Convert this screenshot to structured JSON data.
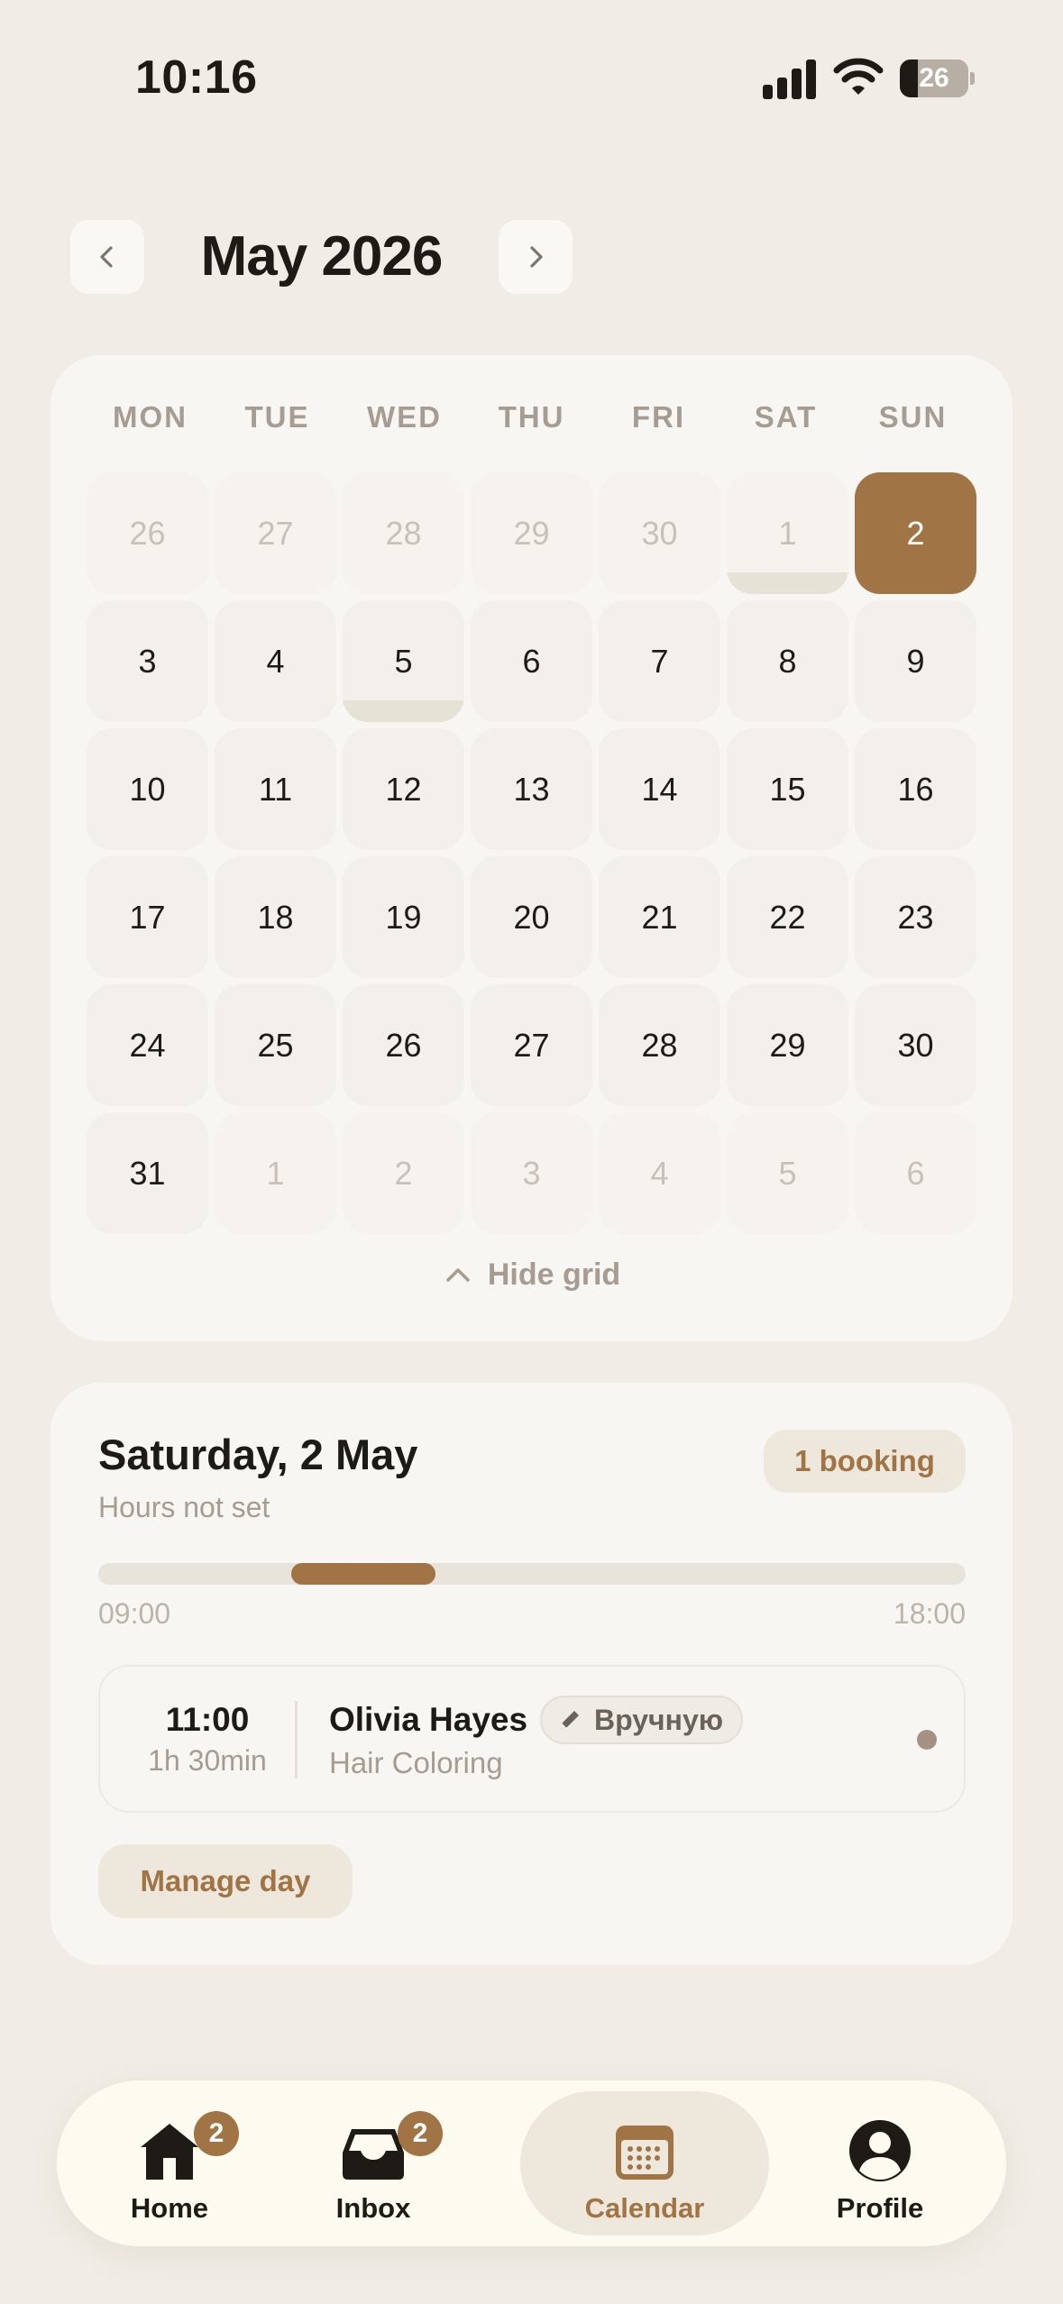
{
  "status_bar": {
    "time": "10:16",
    "battery_level": "26",
    "battery_fraction": 0.26,
    "signal_bars_active": 3,
    "signal_bars_total": 4,
    "icons": [
      "signal-icon",
      "wifi-icon",
      "battery-icon"
    ]
  },
  "header": {
    "month_title": "May 2026",
    "prev_icon": "chevron-left-icon",
    "next_icon": "chevron-right-icon"
  },
  "calendar": {
    "weekdays": [
      "MON",
      "TUE",
      "WED",
      "THU",
      "FRI",
      "SAT",
      "SUN"
    ],
    "weeks": [
      [
        {
          "label": "26",
          "out": true
        },
        {
          "label": "27",
          "out": true
        },
        {
          "label": "28",
          "out": true
        },
        {
          "label": "29",
          "out": true
        },
        {
          "label": "30",
          "out": true
        },
        {
          "label": "1",
          "out": true,
          "marked": true
        },
        {
          "label": "2",
          "selected": true
        }
      ],
      [
        {
          "label": "3"
        },
        {
          "label": "4"
        },
        {
          "label": "5",
          "marked": true
        },
        {
          "label": "6"
        },
        {
          "label": "7"
        },
        {
          "label": "8"
        },
        {
          "label": "9"
        }
      ],
      [
        {
          "label": "10"
        },
        {
          "label": "11"
        },
        {
          "label": "12"
        },
        {
          "label": "13"
        },
        {
          "label": "14"
        },
        {
          "label": "15"
        },
        {
          "label": "16"
        }
      ],
      [
        {
          "label": "17"
        },
        {
          "label": "18"
        },
        {
          "label": "19"
        },
        {
          "label": "20"
        },
        {
          "label": "21"
        },
        {
          "label": "22"
        },
        {
          "label": "23"
        }
      ],
      [
        {
          "label": "24"
        },
        {
          "label": "25"
        },
        {
          "label": "26"
        },
        {
          "label": "27"
        },
        {
          "label": "28"
        },
        {
          "label": "29"
        },
        {
          "label": "30"
        }
      ],
      [
        {
          "label": "31"
        },
        {
          "label": "1",
          "out": true
        },
        {
          "label": "2",
          "out": true
        },
        {
          "label": "3",
          "out": true
        },
        {
          "label": "4",
          "out": true
        },
        {
          "label": "5",
          "out": true
        },
        {
          "label": "6",
          "out": true
        }
      ]
    ],
    "hide_grid_label": "Hide grid",
    "hide_grid_icon": "chevron-up-icon"
  },
  "day_panel": {
    "title": "Saturday, 2 May",
    "subtitle": "Hours not set",
    "booking_count": "1 booking",
    "timeline": {
      "start_label": "09:00",
      "end_label": "18:00",
      "block_start": "11:00",
      "block_end": "12:30"
    },
    "bookings": [
      {
        "time": "11:00",
        "duration": "1h 30min",
        "client": "Olivia Hayes",
        "service": "Hair Coloring",
        "tag": "Вручную",
        "tag_icon": "pencil-icon"
      }
    ],
    "manage_label": "Manage day"
  },
  "tabbar": {
    "tabs": [
      {
        "label": "Home",
        "icon": "home-icon",
        "badge": "2",
        "active": false
      },
      {
        "label": "Inbox",
        "icon": "inbox-icon",
        "badge": "2",
        "active": false
      },
      {
        "label": "Calendar",
        "icon": "calendar-icon",
        "badge": "",
        "active": true
      },
      {
        "label": "Profile",
        "icon": "profile-icon",
        "badge": "",
        "active": false
      }
    ]
  },
  "colors": {
    "background": "#F1EDE6",
    "card": "#F8F6F2",
    "accent": "#A07444",
    "accent_soft": "#EEE7DC",
    "text": "#1E1A16",
    "muted": "#A69C92"
  }
}
